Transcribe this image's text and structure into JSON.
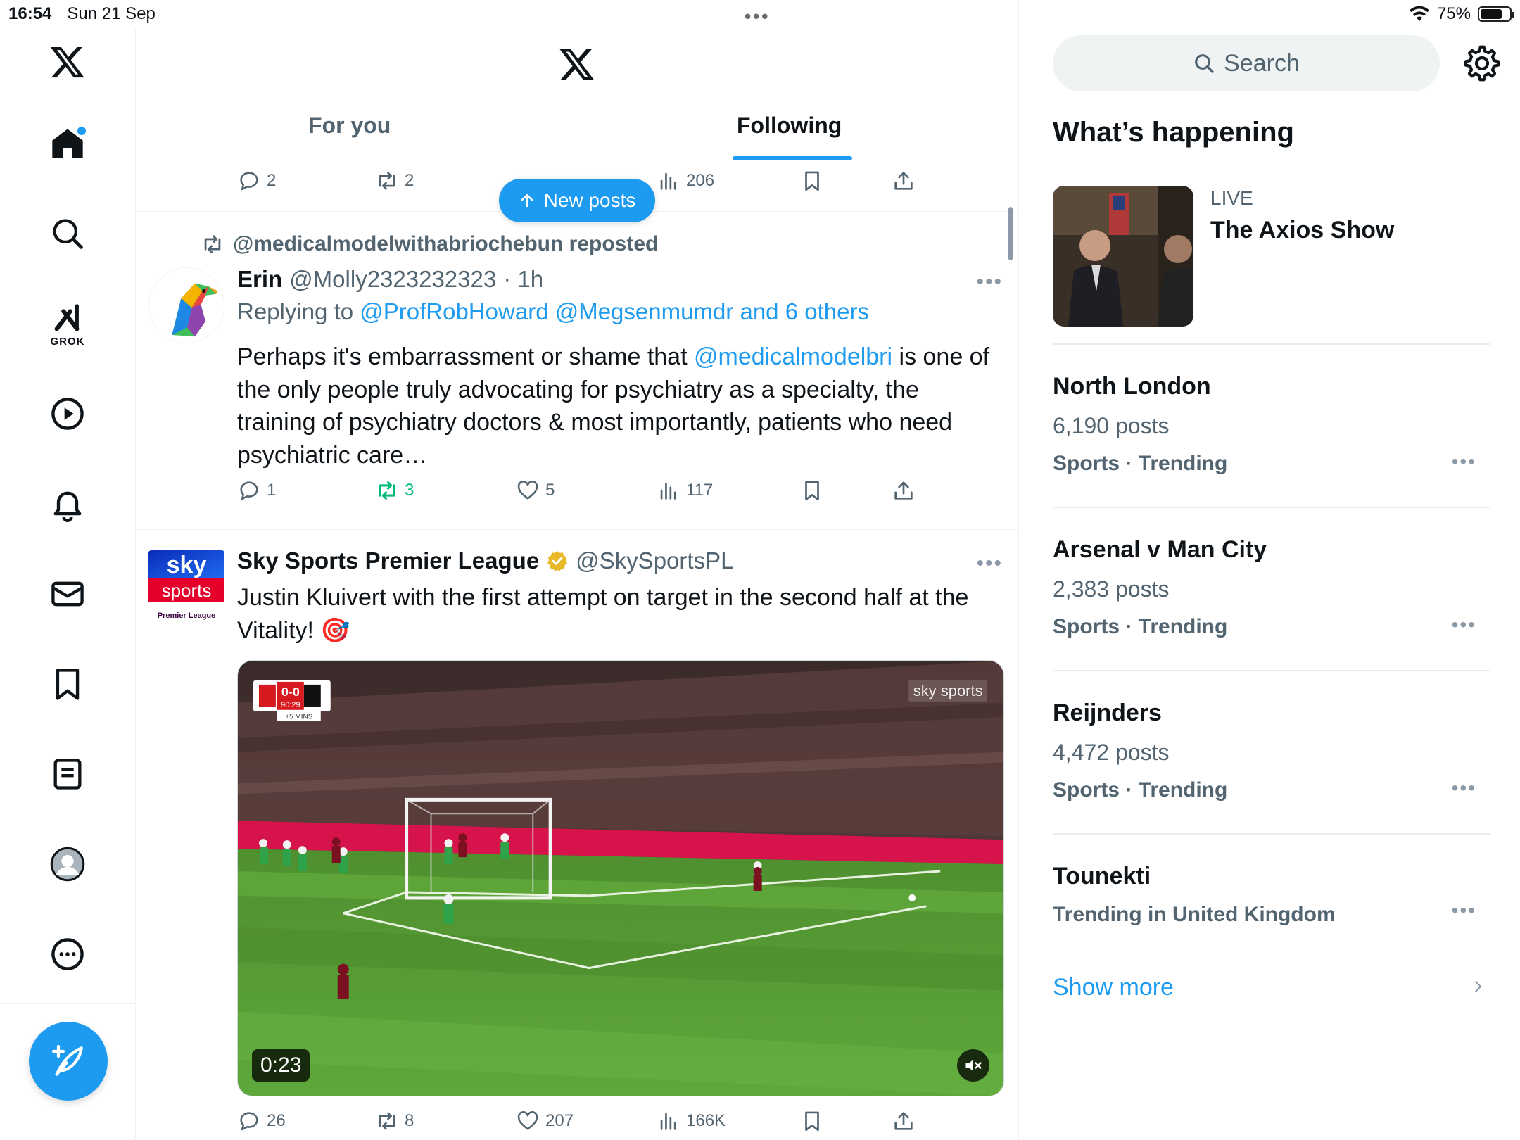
{
  "status_bar": {
    "time": "16:54",
    "date": "Sun 21 Sep",
    "battery": "75%",
    "battery_level": 0.75
  },
  "nav": {
    "grok_label": "GROK",
    "icons": [
      "x-logo-icon",
      "home-icon",
      "search-icon",
      "grok-icon",
      "video-icon",
      "bell-icon",
      "mail-icon",
      "bookmark-icon",
      "list-icon",
      "profile-icon",
      "more-icon",
      "compose-icon"
    ]
  },
  "header": {
    "tabs": [
      {
        "label": "For you",
        "active": false
      },
      {
        "label": "Following",
        "active": true
      }
    ]
  },
  "new_posts_label": "New posts",
  "top_post_actions": {
    "replies": "2",
    "reposts": "2",
    "views": "206"
  },
  "post1": {
    "repost_by": "@medicalmodelwithabriochebun reposted",
    "name": "Erin",
    "handle": "@Molly2323232323",
    "time": "· 1h",
    "reply_prefix": "Replying to",
    "reply_targets": "@ProfRobHoward @Megsenmumdr and 6 others",
    "text_before": "Perhaps it's embarrassment or shame that ",
    "text_mention": "@medicalmodelbri",
    "text_after": " is one of the only people truly advocating for psychiatry as a specialty, the training of psychiatry doctors & most importantly, patients who need psychiatric care…",
    "replies": "1",
    "reposts": "3",
    "likes": "5",
    "views": "117"
  },
  "post2": {
    "name": "Sky Sports Premier League",
    "handle": "@SkySportsPL",
    "avatar_top": "sky",
    "avatar_mid": "sports",
    "avatar_bottom": "Premier League",
    "text": "Justin Kluivert with the first attempt on target in the second half at the Vitality! 🎯",
    "video_time": "0:23",
    "score": "0-0",
    "match_clock": "90:29",
    "added_time": "+5 MINS",
    "broadcaster": "sky sports",
    "replies": "26",
    "reposts": "8",
    "likes": "207",
    "views": "166K"
  },
  "sidebar": {
    "search_placeholder": "Search",
    "title": "What’s happening",
    "live": {
      "label": "LIVE",
      "title": "The Axios Show"
    },
    "trends": [
      {
        "title": "North London",
        "count": "6,190 posts",
        "category": "Sports · Trending"
      },
      {
        "title": "Arsenal v Man City",
        "count": "2,383 posts",
        "category": "Sports · Trending"
      },
      {
        "title": "Reijnders",
        "count": "4,472 posts",
        "category": "Sports · Trending"
      },
      {
        "title": "Tounekti",
        "count": "",
        "category": "Trending in United Kingdom"
      }
    ],
    "show_more": "Show more"
  },
  "colors": {
    "accent": "#1d9bf0",
    "repost_green": "#00ba7c",
    "secondary_text": "#536471"
  }
}
